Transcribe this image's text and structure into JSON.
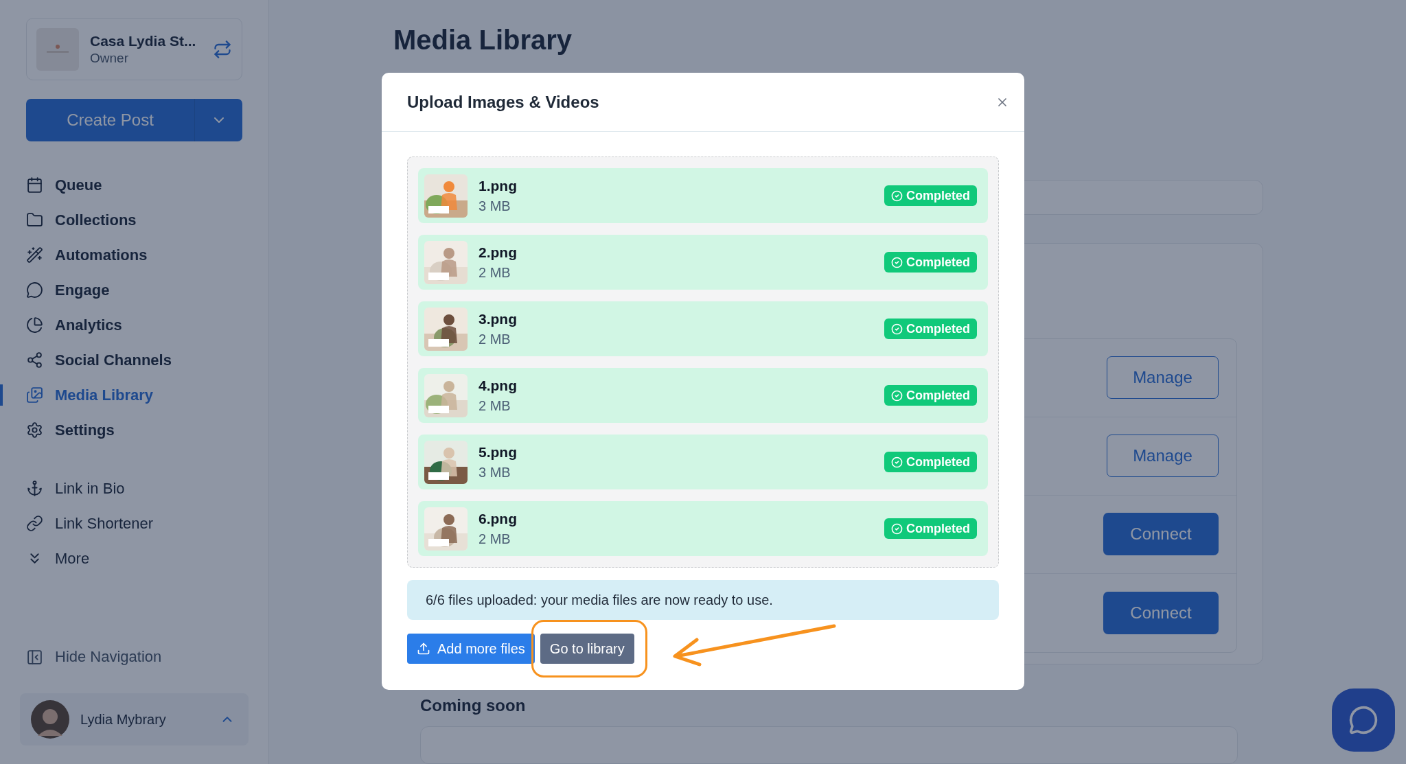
{
  "account": {
    "name": "Casa Lydia St...",
    "role": "Owner"
  },
  "create_button": {
    "label": "Create Post"
  },
  "nav_main": [
    {
      "label": "Queue",
      "selected": false
    },
    {
      "label": "Collections",
      "selected": false
    },
    {
      "label": "Automations",
      "selected": false
    },
    {
      "label": "Engage",
      "selected": false
    },
    {
      "label": "Analytics",
      "selected": false
    },
    {
      "label": "Social Channels",
      "selected": false
    },
    {
      "label": "Media Library",
      "selected": true
    },
    {
      "label": "Settings",
      "selected": false
    }
  ],
  "nav_tools": [
    {
      "label": "Link in Bio"
    },
    {
      "label": "Link Shortener"
    },
    {
      "label": "More"
    }
  ],
  "hide_navigation": "Hide Navigation",
  "user": {
    "name": "Lydia Mybrary"
  },
  "page": {
    "title": "Media Library"
  },
  "channel_buttons": [
    {
      "label": "Manage",
      "kind": "outline"
    },
    {
      "label": "Manage",
      "kind": "outline"
    },
    {
      "label": "Connect",
      "kind": "solid"
    },
    {
      "label": "Connect",
      "kind": "solid"
    }
  ],
  "coming_soon": "Coming soon",
  "modal": {
    "title": "Upload Images & Videos",
    "files": [
      {
        "name": "1.png",
        "size": "3 MB",
        "status": "Completed"
      },
      {
        "name": "2.png",
        "size": "2 MB",
        "status": "Completed"
      },
      {
        "name": "3.png",
        "size": "2 MB",
        "status": "Completed"
      },
      {
        "name": "4.png",
        "size": "2 MB",
        "status": "Completed"
      },
      {
        "name": "5.png",
        "size": "3 MB",
        "status": "Completed"
      },
      {
        "name": "6.png",
        "size": "2 MB",
        "status": "Completed"
      }
    ],
    "message": "6/6 files uploaded: your media files are now ready to use.",
    "buttons": [
      {
        "label": "Add more files",
        "kind": "primary",
        "highlighted": false
      },
      {
        "label": "Go to library",
        "kind": "secondary",
        "highlighted": true
      }
    ]
  }
}
